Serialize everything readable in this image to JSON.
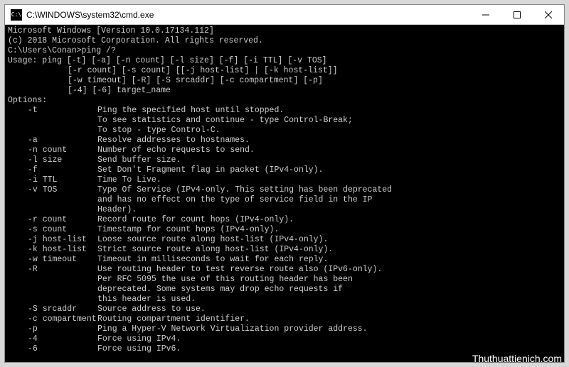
{
  "titlebar": {
    "icon_text": "C:\\",
    "title": "C:\\WINDOWS\\system32\\cmd.exe"
  },
  "console": {
    "banner1": "Microsoft Windows [Version 10.0.17134.112]",
    "banner2": "(c) 2018 Microsoft Corporation. All rights reserved.",
    "prompt": "C:\\Users\\Conan>",
    "command": "ping /?",
    "usage_label": "Usage: ",
    "usage_lines": [
      "ping [-t] [-a] [-n count] [-l size] [-f] [-i TTL] [-v TOS]",
      "[-r count] [-s count] [[-j host-list] | [-k host-list]]",
      "[-w timeout] [-R] [-S srcaddr] [-c compartment] [-p]",
      "[-4] [-6] target_name"
    ],
    "options_label": "Options:",
    "options": [
      {
        "flag": "-t",
        "desc": [
          "Ping the specified host until stopped.",
          "To see statistics and continue - type Control-Break;",
          "To stop - type Control-C."
        ]
      },
      {
        "flag": "-a",
        "desc": [
          "Resolve addresses to hostnames."
        ]
      },
      {
        "flag": "-n count",
        "desc": [
          "Number of echo requests to send."
        ]
      },
      {
        "flag": "-l size",
        "desc": [
          "Send buffer size."
        ]
      },
      {
        "flag": "-f",
        "desc": [
          "Set Don't Fragment flag in packet (IPv4-only)."
        ]
      },
      {
        "flag": "-i TTL",
        "desc": [
          "Time To Live."
        ]
      },
      {
        "flag": "-v TOS",
        "desc": [
          "Type Of Service (IPv4-only. This setting has been deprecated",
          "and has no effect on the type of service field in the IP",
          "Header)."
        ]
      },
      {
        "flag": "-r count",
        "desc": [
          "Record route for count hops (IPv4-only)."
        ]
      },
      {
        "flag": "-s count",
        "desc": [
          "Timestamp for count hops (IPv4-only)."
        ]
      },
      {
        "flag": "-j host-list",
        "desc": [
          "Loose source route along host-list (IPv4-only)."
        ]
      },
      {
        "flag": "-k host-list",
        "desc": [
          "Strict source route along host-list (IPv4-only)."
        ]
      },
      {
        "flag": "-w timeout",
        "desc": [
          "Timeout in milliseconds to wait for each reply."
        ]
      },
      {
        "flag": "-R",
        "desc": [
          "Use routing header to test reverse route also (IPv6-only).",
          "Per RFC 5095 the use of this routing header has been",
          "deprecated. Some systems may drop echo requests if",
          "this header is used."
        ]
      },
      {
        "flag": "-S srcaddr",
        "desc": [
          "Source address to use."
        ]
      },
      {
        "flag": "-c compartment",
        "desc": [
          "Routing compartment identifier."
        ]
      },
      {
        "flag": "-p",
        "desc": [
          "Ping a Hyper-V Network Virtualization provider address."
        ]
      },
      {
        "flag": "-4",
        "desc": [
          "Force using IPv4."
        ]
      },
      {
        "flag": "-6",
        "desc": [
          "Force using IPv6."
        ]
      }
    ]
  },
  "watermark": "Thuthuattienich.com"
}
